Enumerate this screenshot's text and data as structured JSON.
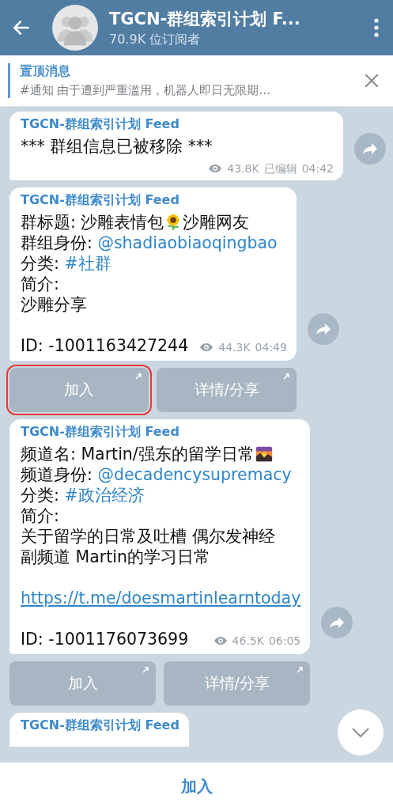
{
  "header": {
    "title": "TGCN-群组索引计划 F...",
    "subtitle": "70.9K 位订阅者"
  },
  "pinned": {
    "label": "置顶消息",
    "text": "#通知  由于遭到严重滥用，机器人即日无限期…"
  },
  "messages": [
    {
      "author": "TGCN-群组索引计划 Feed",
      "lines": [
        {
          "gap": false,
          "segments": [
            {
              "kind": "text",
              "text": "*** 群组信息已被移除 ***"
            }
          ]
        }
      ],
      "views": "43.8K",
      "edited": "已编辑",
      "time": "04:42"
    },
    {
      "author": "TGCN-群组索引计划 Feed",
      "lines": [
        {
          "gap": false,
          "segments": [
            {
              "kind": "text",
              "text": "群标题: 沙雕表情包"
            },
            {
              "kind": "flower"
            },
            {
              "kind": "text",
              "text": "沙雕网友"
            }
          ]
        },
        {
          "gap": false,
          "segments": [
            {
              "kind": "text",
              "text": "群组身份: "
            },
            {
              "kind": "mention",
              "text": "@shadiaobiaoqingbao"
            }
          ]
        },
        {
          "gap": false,
          "segments": [
            {
              "kind": "text",
              "text": "分类: "
            },
            {
              "kind": "tag",
              "text": "#社群"
            }
          ]
        },
        {
          "gap": false,
          "segments": [
            {
              "kind": "text",
              "text": "简介:"
            }
          ]
        },
        {
          "gap": false,
          "segments": [
            {
              "kind": "text",
              "text": "沙雕分享"
            }
          ]
        },
        {
          "gap": true,
          "segments": [
            {
              "kind": "text",
              "text": "ID: -1001163427244"
            }
          ]
        }
      ],
      "views": "44.3K",
      "time": "04:49",
      "buttons": [
        {
          "label": "加入",
          "highlighted": true
        },
        {
          "label": "详情/分享",
          "highlighted": false
        }
      ]
    },
    {
      "author": "TGCN-群组索引计划 Feed",
      "lines": [
        {
          "gap": false,
          "segments": [
            {
              "kind": "text",
              "text": "频道名: Martin/强东的留学日常"
            },
            {
              "kind": "sunset"
            }
          ]
        },
        {
          "gap": false,
          "segments": [
            {
              "kind": "text",
              "text": "频道身份: "
            },
            {
              "kind": "mention",
              "text": "@decadencysupremacy"
            }
          ]
        },
        {
          "gap": false,
          "segments": [
            {
              "kind": "text",
              "text": "分类: "
            },
            {
              "kind": "tag",
              "text": "#政治经济"
            }
          ]
        },
        {
          "gap": false,
          "segments": [
            {
              "kind": "text",
              "text": "简介:"
            }
          ]
        },
        {
          "gap": false,
          "segments": [
            {
              "kind": "text",
              "text": "关于留学的日常及吐槽 偶尔发神经"
            }
          ]
        },
        {
          "gap": false,
          "segments": [
            {
              "kind": "text",
              "text": "副频道 Martin的学习日常"
            }
          ]
        },
        {
          "gap": true,
          "segments": [
            {
              "kind": "url",
              "text": "https://t.me/doesmartinlearntoday"
            }
          ]
        },
        {
          "gap": true,
          "segments": [
            {
              "kind": "text",
              "text": "ID: -1001176073699"
            }
          ]
        }
      ],
      "views": "46.5K",
      "time": "06:05",
      "buttons": [
        {
          "label": "加入",
          "highlighted": false
        },
        {
          "label": "详情/分享",
          "highlighted": false
        }
      ]
    },
    {
      "author": "TGCN-群组索引计划 Feed"
    }
  ],
  "bottom_button": "加入"
}
